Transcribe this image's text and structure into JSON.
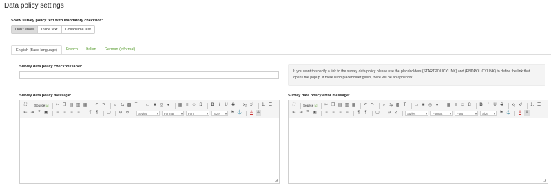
{
  "page": {
    "title": "Data policy settings"
  },
  "show_policy": {
    "label": "Show survey policy text with mandatory checkbox:",
    "options": [
      "Don't show",
      "Inline text",
      "Collapsible text"
    ],
    "selected": "Don't show"
  },
  "tabs": [
    {
      "label": "English (Base language)",
      "active": true
    },
    {
      "label": "French",
      "active": false
    },
    {
      "label": "Italian",
      "active": false
    },
    {
      "label": "German (informal)",
      "active": false
    }
  ],
  "checkbox_label_field": {
    "label": "Survey data policy checkbox label:",
    "value": ""
  },
  "info": {
    "text": "If you want to specify a link to the survey data policy please use the placeholders {STARTPOLICYLINK} and {ENDPOLICYLINK} to define the link that opens the popup. If there is no placeholder given, there will be an appendix."
  },
  "editors": {
    "message_label": "Survey data policy message:",
    "error_label": "Survey data policy error message:"
  },
  "toolbar": {
    "source": "Source",
    "styles": "Styles",
    "format": "Format",
    "font": "Font",
    "size": "Size"
  },
  "colors": {
    "accent": "#5fae4e",
    "tab_link": "#5a9e32"
  }
}
